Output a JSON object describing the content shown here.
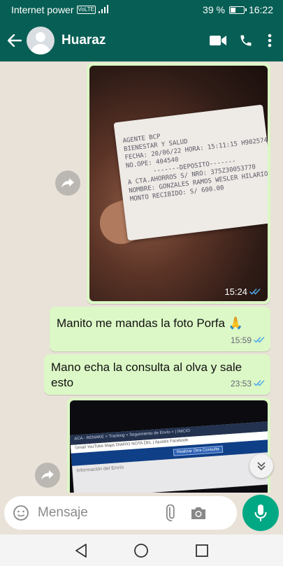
{
  "status_bar": {
    "carrier": "Internet power",
    "network_badge": "VoLTE",
    "battery_percent_label": "39 %",
    "battery_level": 0.39,
    "time": "16:22"
  },
  "header": {
    "contact_name": "Huaraz",
    "icons": [
      "back-arrow-icon",
      "video-call-icon",
      "phone-icon",
      "more-vert-icon"
    ]
  },
  "messages": [
    {
      "type": "image",
      "time": "15:24",
      "receipt_lines": [
        "AGENTE BCP",
        "BIENESTAR Y SALUD",
        "FECHA: 20/06/22 HORA: 15:11:15 H902574",
        "NO.OPE: 404540",
        "-------DEPOSITO-------",
        "A  CTA.AHORROS   S/  NRO: 375Z30053770",
        "NOMBRE: GONZALES RAMOS WESLER HILARIO",
        "MONTO RECIBIDO:       S/       600.00"
      ]
    },
    {
      "type": "text",
      "text": "Manito me mandas la foto Porfa 🙏",
      "time": "15:59"
    },
    {
      "type": "text",
      "text": "Mano  echa la consulta al olva y sale esto",
      "time": "23:53"
    },
    {
      "type": "image",
      "screen_top": "ACA - REMAKE   ×   Tracking   ×   Seguimiento de Envío  ×   |   INICIO",
      "screen_tabs": "Gmail   YouTube   Maps   DIARIO NOTA DEL   |   Ajustes   Facebook",
      "screen_button": "Realizar Otra Consulta",
      "screen_text": "Información del Envío"
    }
  ],
  "input": {
    "placeholder": "Mensaje"
  },
  "colors": {
    "header": "#075e54",
    "outgoing_bubble": "#dcf8c6",
    "chat_bg": "#e9e2d8",
    "mic_button": "#00a884",
    "read_ticks": "#4fa8e8"
  }
}
